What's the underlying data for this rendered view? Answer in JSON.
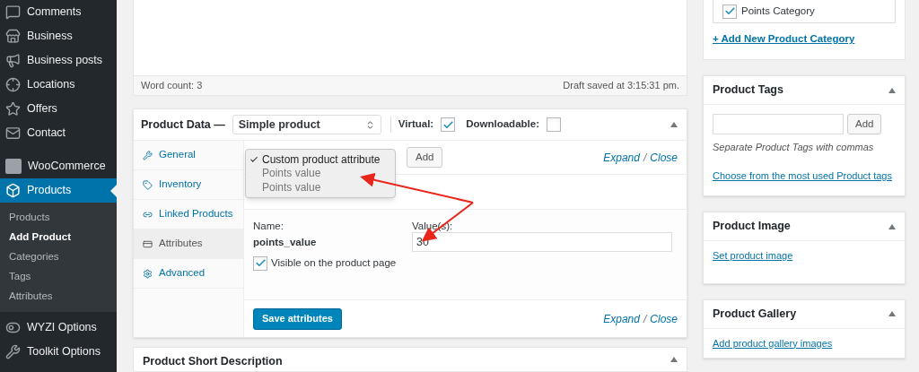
{
  "sidebar": {
    "items": [
      {
        "label": "Comments",
        "active": false
      },
      {
        "label": "Business",
        "active": false
      },
      {
        "label": "Business posts",
        "active": false
      },
      {
        "label": "Locations",
        "active": false
      },
      {
        "label": "Offers",
        "active": false
      },
      {
        "label": "Contact",
        "active": false
      },
      {
        "label": "WooCommerce",
        "active": false
      },
      {
        "label": "Products",
        "active": true,
        "children": [
          {
            "label": "Products",
            "selected": false
          },
          {
            "label": "Add Product",
            "selected": true
          },
          {
            "label": "Categories",
            "selected": false
          },
          {
            "label": "Tags",
            "selected": false
          },
          {
            "label": "Attributes",
            "selected": false
          }
        ]
      },
      {
        "label": "WYZI Options",
        "active": false
      },
      {
        "label": "Toolkit Options",
        "active": false
      }
    ]
  },
  "editor": {
    "word_count": "Word count: 3",
    "draft_status": "Draft saved at 3:15:31 pm."
  },
  "product_data": {
    "title": "Product Data —",
    "product_type": "Simple product",
    "virtual": {
      "label": "Virtual:",
      "checked": true
    },
    "downloadable": {
      "label": "Downloadable:",
      "checked": false
    },
    "tabs": [
      {
        "label": "General",
        "selected": false
      },
      {
        "label": "Inventory",
        "selected": false
      },
      {
        "label": "Linked Products",
        "selected": false
      },
      {
        "label": "Attributes",
        "selected": true
      },
      {
        "label": "Advanced",
        "selected": false
      }
    ],
    "attribute_select": {
      "options": [
        {
          "label": "Custom product attribute",
          "selected": true
        },
        {
          "label": "Points value",
          "selected": false
        },
        {
          "label": "Points value",
          "selected": false
        }
      ]
    },
    "add_button": "Add",
    "expand_close": [
      "Expand",
      "/",
      "Close"
    ],
    "attribute": {
      "name_label": "Name:",
      "name": "points_value",
      "values_label": "Value(s):",
      "value": "30",
      "visible_label": "Visible on the product page",
      "visible": true
    },
    "save_button": "Save attributes",
    "footer_expand_close": [
      "Expand",
      "/",
      "Close"
    ]
  },
  "short_description": {
    "title": "Product Short Description"
  },
  "categories": {
    "items": [
      {
        "label": "Points Category",
        "checked": true
      }
    ],
    "add_link": "+ Add New Product Category"
  },
  "product_tags": {
    "title": "Product Tags",
    "add_button": "Add",
    "hint": "Separate Product Tags with commas",
    "link": "Choose from the most used Product tags"
  },
  "product_image": {
    "title": "Product Image",
    "link": "Set product image"
  },
  "product_gallery": {
    "title": "Product Gallery",
    "link": "Add product gallery images"
  }
}
